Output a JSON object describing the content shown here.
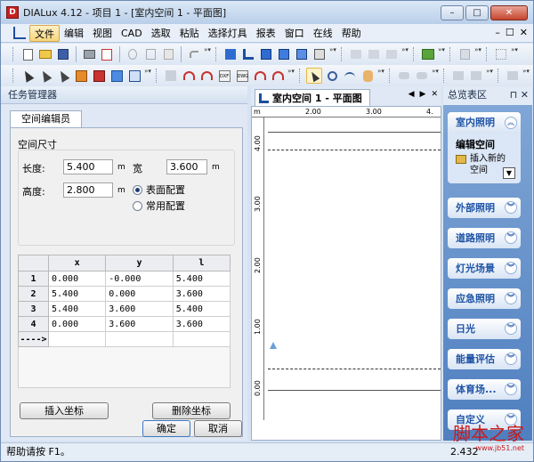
{
  "window": {
    "title": "DIALux 4.12 - 项目 1 - [室内空间 1 - 平面图]",
    "controls": {
      "minimize": "–",
      "maximize": "□",
      "close": "✕"
    }
  },
  "menu": {
    "items": [
      "文件",
      "编辑",
      "视图",
      "CAD",
      "选取",
      "粘贴",
      "选择灯具",
      "报表",
      "窗口",
      "在线",
      "帮助"
    ],
    "right": [
      "–",
      "☐",
      "✕"
    ]
  },
  "left_panel": {
    "header": "任务管理器",
    "tab": "空间编辑员",
    "section_title": "空间尺寸",
    "length_label": "长度:",
    "length_value": "5.400",
    "length_unit": "m",
    "width_label": "宽",
    "width_value": "3.600",
    "width_unit": "m",
    "height_label": "高度:",
    "height_value": "2.800",
    "height_unit": "m",
    "radio_surface": "表面配置",
    "radio_common": "常用配置",
    "table": {
      "headers": [
        "",
        "x",
        "y",
        "l"
      ],
      "rows": [
        [
          "1",
          "0.000",
          "-0.000",
          "5.400"
        ],
        [
          "2",
          "5.400",
          "0.000",
          "3.600"
        ],
        [
          "3",
          "5.400",
          "3.600",
          "5.400"
        ],
        [
          "4",
          "0.000",
          "3.600",
          "3.600"
        ],
        [
          "---->",
          "",
          "",
          ""
        ]
      ]
    },
    "insert_button": "插入坐标",
    "delete_button": "删除坐标",
    "ok_button": "确定",
    "cancel_button": "取消"
  },
  "center": {
    "tab_title": "室内空间 1 - 平面图",
    "ruler_top": [
      "m",
      "2.00",
      "3.00",
      "4."
    ],
    "ruler_left": [
      "4.00",
      "3.00",
      "2.00",
      "1.00",
      "0.00"
    ]
  },
  "right_panel": {
    "header": "总览表区",
    "expanded": {
      "title": "室内照明",
      "subtitle": "编辑空间",
      "action": "插入新的空间"
    },
    "items": [
      "外部照明",
      "道路照明",
      "灯光场景",
      "应急照明",
      "日光",
      "能量评估",
      "体育场...",
      "自定义"
    ]
  },
  "status": {
    "text": "帮助请按 F1。",
    "coord": "2.432"
  },
  "watermark": {
    "text": "脚本之家",
    "sub": "www.jb51.net"
  }
}
